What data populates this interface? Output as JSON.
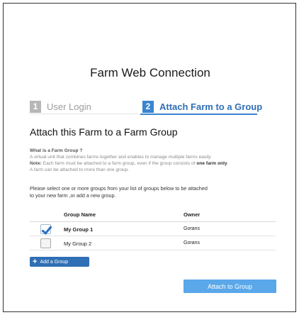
{
  "app": {
    "title": "Farm Web Connection"
  },
  "steps": [
    {
      "number": "1",
      "label": "User Login"
    },
    {
      "number": "2",
      "label": "Attach Farm to a Group"
    }
  ],
  "section": {
    "title": "Attach this Farm to a Farm Group"
  },
  "info": {
    "question": "What is a Farm Group ?",
    "description": "A virtual unit that combines farms together and enables to manage multiple farms easily.",
    "note_label": "Note:",
    "note_text": " Each farm must be attached to a farm group, even if the group consists of ",
    "note_strong": "one farm only",
    "note_end": ".",
    "multi": "A farm can be attached to more than one group."
  },
  "instructions": {
    "line1": "Please select one or more groups from your list of groups below to be attached",
    "line2": "to your new farm ,or add a new group."
  },
  "table": {
    "headers": {
      "name": "Group Name",
      "owner": "Owner"
    },
    "rows": [
      {
        "name": "My Group 1",
        "owner": "Gorans",
        "checked": true
      },
      {
        "name": "My Group 2",
        "owner": "Gorans",
        "checked": false
      }
    ]
  },
  "buttons": {
    "add_icon": "+",
    "add_label": "Add a Group",
    "attach_label": "Attach to Group"
  },
  "colors": {
    "accent": "#3a84d0",
    "attach_button": "#5aa8ea",
    "add_button": "#2f6fb5"
  }
}
